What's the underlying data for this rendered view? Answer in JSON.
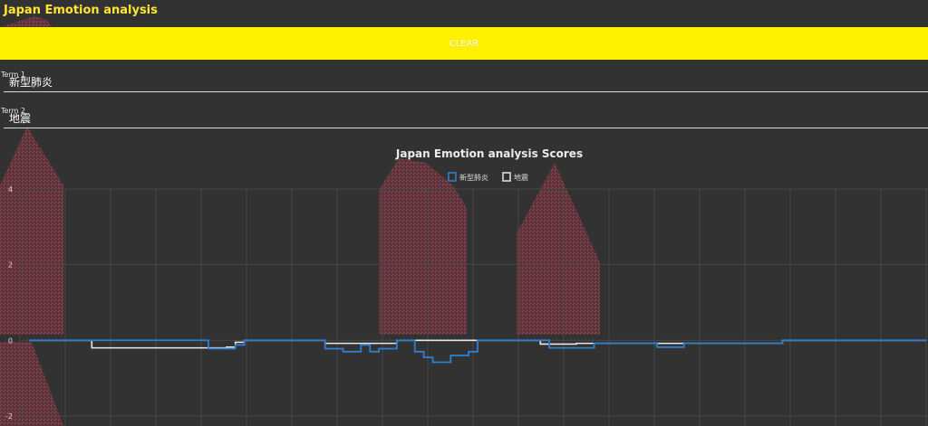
{
  "header": {
    "title": "Japan Emotion analysis"
  },
  "toolbar": {
    "clear_label": "CLEAR"
  },
  "terms": [
    {
      "label": "Term 1",
      "value": "新型肺炎"
    },
    {
      "label": "Term 2",
      "value": "地震"
    }
  ],
  "colors": {
    "background": "#323232",
    "title": "#ffe633",
    "clear_button": "#fff200",
    "series_1": "#2f7fcf",
    "series_2": "#e8e8e8",
    "background_art": "#7a3a44"
  },
  "chart_data": {
    "type": "line",
    "step": true,
    "title": "Japan Emotion analysis Scores",
    "legend_position": "top-center",
    "grid": true,
    "ylim": [
      -2.6,
      4
    ],
    "yticks": [
      -2,
      0,
      2,
      4
    ],
    "x": [
      0,
      1,
      2,
      3,
      4,
      5,
      6,
      7,
      8,
      9,
      10,
      11,
      12,
      13,
      14,
      15,
      16,
      17,
      18,
      19,
      20,
      21,
      22,
      23,
      24,
      25,
      26,
      27,
      28,
      29,
      30,
      31,
      32,
      33,
      34,
      35,
      36,
      37,
      38,
      39,
      40,
      41,
      42,
      43,
      44,
      45,
      46,
      47,
      48,
      49,
      50,
      51,
      52,
      53,
      54,
      55,
      56,
      57,
      58,
      59,
      60,
      61,
      62,
      63,
      64,
      65,
      66,
      67,
      68,
      69,
      70,
      71,
      72,
      73,
      74,
      75,
      76,
      77,
      78,
      79,
      80,
      81,
      82,
      83,
      84,
      85,
      86,
      87,
      88,
      89,
      90,
      91,
      92,
      93,
      94,
      95,
      96,
      97,
      98,
      99,
      100
    ],
    "series": [
      {
        "name": "新型肺炎",
        "values": [
          0,
          0,
          0,
          0,
          0,
          0,
          0,
          0,
          0,
          0,
          0,
          0,
          0,
          0,
          0,
          0,
          0,
          0,
          0,
          0,
          -0.22,
          -0.22,
          -0.22,
          -0.12,
          0,
          0,
          0,
          0,
          0,
          0,
          0,
          0,
          0,
          -0.22,
          -0.22,
          -0.3,
          -0.3,
          -0.12,
          -0.3,
          -0.22,
          -0.22,
          0,
          0,
          -0.3,
          -0.45,
          -0.58,
          -0.58,
          -0.4,
          -0.4,
          -0.3,
          0,
          0,
          0,
          0,
          0,
          0,
          0,
          0,
          -0.2,
          -0.2,
          -0.2,
          -0.2,
          -0.2,
          -0.08,
          -0.08,
          -0.08,
          -0.08,
          -0.08,
          -0.08,
          -0.08,
          -0.18,
          -0.18,
          -0.18,
          -0.08,
          -0.08,
          -0.08,
          -0.08,
          -0.08,
          -0.08,
          -0.08,
          -0.08,
          -0.08,
          -0.08,
          -0.08,
          0,
          0,
          0,
          0,
          0,
          0,
          0,
          0,
          0,
          0,
          0,
          0,
          0,
          0,
          0,
          0,
          0
        ]
      },
      {
        "name": "地震",
        "values": [
          0,
          0,
          0,
          0,
          0,
          0,
          0,
          -0.2,
          -0.2,
          -0.2,
          -0.2,
          -0.2,
          -0.2,
          -0.2,
          -0.2,
          -0.2,
          -0.2,
          -0.2,
          -0.2,
          -0.2,
          -0.2,
          -0.2,
          -0.18,
          -0.05,
          0,
          0,
          0,
          0,
          0,
          0,
          0,
          0,
          0,
          -0.08,
          -0.08,
          -0.08,
          -0.08,
          -0.08,
          -0.08,
          -0.08,
          -0.08,
          0,
          0,
          0,
          0,
          0,
          0,
          0,
          0,
          0,
          0,
          0,
          0,
          0,
          0,
          0,
          0,
          -0.1,
          -0.1,
          -0.1,
          -0.1,
          -0.08,
          -0.08,
          -0.08,
          -0.08,
          -0.08,
          -0.08,
          -0.08,
          -0.08,
          -0.08,
          -0.08,
          -0.08,
          -0.08,
          -0.08,
          -0.08,
          -0.08,
          -0.08,
          -0.08,
          -0.08,
          -0.08,
          -0.08,
          -0.08,
          -0.08,
          -0.08,
          0,
          0,
          0,
          0,
          0,
          0,
          0,
          0,
          0,
          0,
          0,
          0,
          0,
          0,
          0,
          0,
          0
        ]
      }
    ]
  }
}
